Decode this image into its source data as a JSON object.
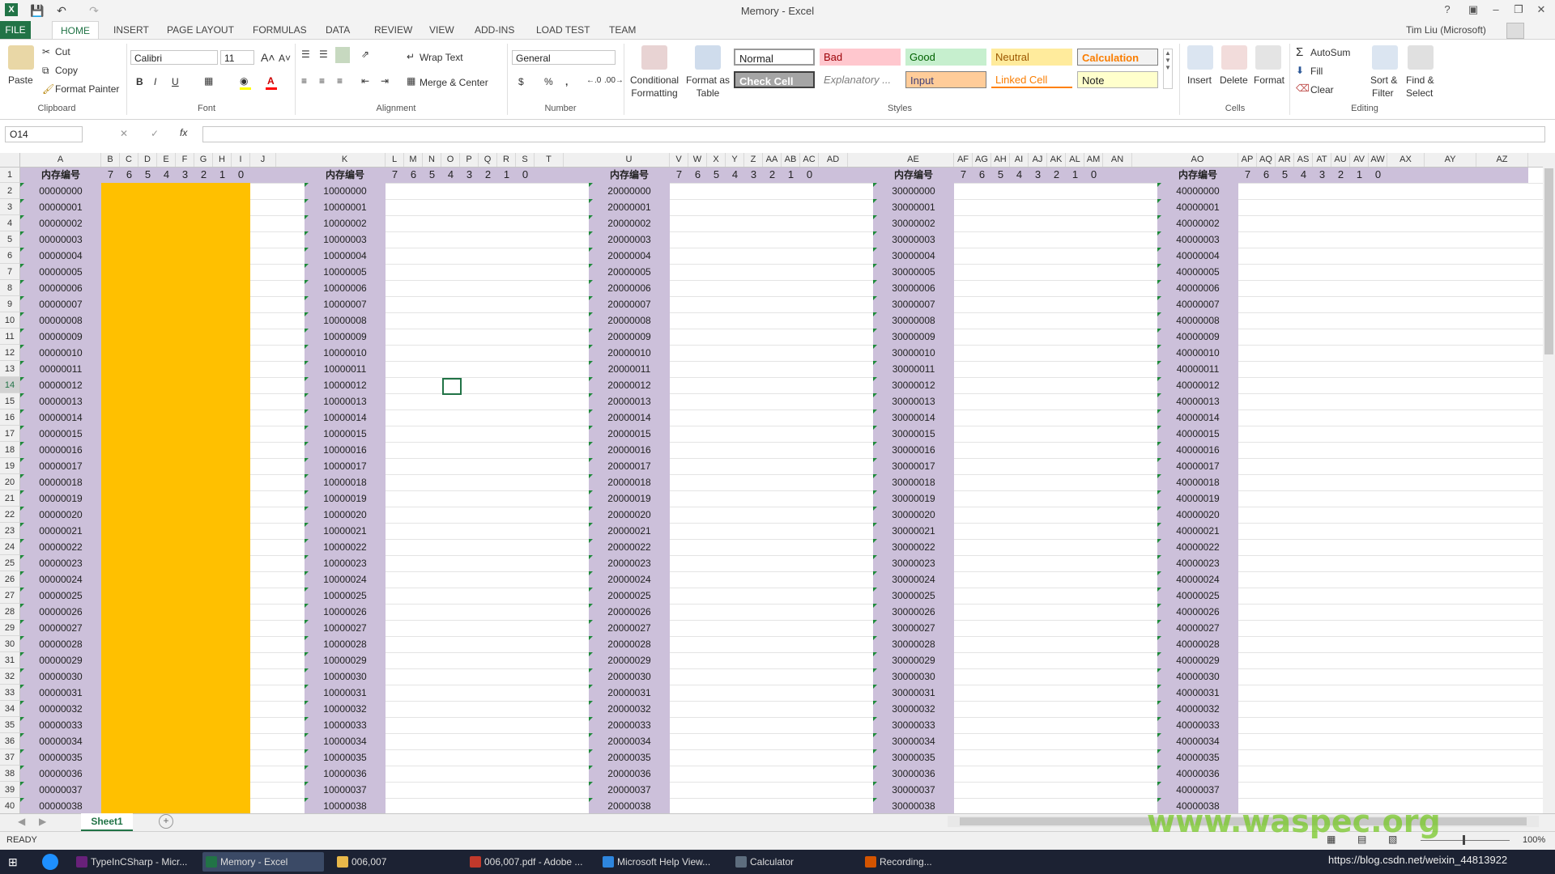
{
  "window": {
    "title": "Memory - Excel",
    "user": "Tim Liu (Microsoft)"
  },
  "tabs": [
    "FILE",
    "HOME",
    "INSERT",
    "PAGE LAYOUT",
    "FORMULAS",
    "DATA",
    "REVIEW",
    "VIEW",
    "ADD-INS",
    "LOAD TEST",
    "TEAM"
  ],
  "clipboard": {
    "paste": "Paste",
    "cut": "Cut",
    "copy": "Copy",
    "format_painter": "Format Painter",
    "label": "Clipboard"
  },
  "font": {
    "name": "Calibri",
    "size": "11",
    "bold": "B",
    "italic": "I",
    "underline": "U",
    "label": "Font"
  },
  "alignment": {
    "wrap_text": "Wrap Text",
    "merge_center": "Merge & Center",
    "label": "Alignment"
  },
  "number": {
    "format": "General",
    "currency": "$",
    "percent": "%",
    "comma": ",",
    "label": "Number"
  },
  "styles_cmds": {
    "conditional": "Conditional",
    "formatting": "Formatting",
    "format_as": "Format as",
    "table": "Table",
    "label": "Styles"
  },
  "styles": {
    "normal": "Normal",
    "bad": "Bad",
    "good": "Good",
    "neutral": "Neutral",
    "calculation": "Calculation",
    "check_cell": "Check Cell",
    "explanatory": "Explanatory ...",
    "input": "Input",
    "linked_cell": "Linked Cell",
    "note": "Note"
  },
  "cells_cmds": {
    "insert": "Insert",
    "delete": "Delete",
    "format": "Format",
    "label": "Cells"
  },
  "editing": {
    "autosum": "AutoSum",
    "fill": "Fill",
    "clear": "Clear",
    "sort": "Sort &",
    "filter": "Filter",
    "find": "Find &",
    "select": "Select",
    "label": "Editing"
  },
  "formula_bar": {
    "name_box": "O14",
    "cancel": "✕",
    "enter": "✓",
    "fx": "fx",
    "value": ""
  },
  "columns": {
    "headers_a": [
      "A",
      "B",
      "C",
      "D",
      "E",
      "F",
      "G",
      "H",
      "I",
      "J"
    ],
    "headers_b": [
      "K",
      "L",
      "M",
      "N",
      "O",
      "P",
      "Q",
      "R",
      "S",
      "T"
    ],
    "headers_c": [
      "U",
      "V",
      "W",
      "X",
      "Y",
      "Z",
      "AA",
      "AB",
      "AC",
      "AD"
    ],
    "headers_d": [
      "AE",
      "AF",
      "AG",
      "AH",
      "AI",
      "AJ",
      "AK",
      "AL",
      "AM",
      "AN"
    ],
    "headers_e": [
      "AO",
      "AP",
      "AQ",
      "AR",
      "AS",
      "AT",
      "AU",
      "AV",
      "AW",
      "AX",
      "AY",
      "AZ"
    ]
  },
  "header_row": {
    "label": "内存编号",
    "bits": [
      "7",
      "6",
      "5",
      "4",
      "3",
      "2",
      "1",
      "0"
    ]
  },
  "row_numbers": [
    "1",
    "2",
    "3",
    "4",
    "5",
    "6",
    "7",
    "8",
    "9",
    "10",
    "11",
    "12",
    "13",
    "14",
    "15",
    "16",
    "17",
    "18",
    "19",
    "20",
    "21",
    "22",
    "23",
    "24",
    "25",
    "26",
    "27",
    "28",
    "29",
    "30",
    "31",
    "32",
    "33",
    "34",
    "35",
    "36",
    "37",
    "38",
    "39",
    "40"
  ],
  "blocks": [
    {
      "addresses": [
        "00000000",
        "00000001",
        "00000002",
        "00000003",
        "00000004",
        "00000005",
        "00000006",
        "00000007",
        "00000008",
        "00000009",
        "00000010",
        "00000011",
        "00000012",
        "00000013",
        "00000014",
        "00000015",
        "00000016",
        "00000017",
        "00000018",
        "00000019",
        "00000020",
        "00000021",
        "00000022",
        "00000023",
        "00000024",
        "00000025",
        "00000026",
        "00000027",
        "00000028",
        "00000029",
        "00000030",
        "00000031",
        "00000032",
        "00000033",
        "00000034",
        "00000035",
        "00000036",
        "00000037",
        "00000038"
      ]
    },
    {
      "addresses": [
        "10000000",
        "10000001",
        "10000002",
        "10000003",
        "10000004",
        "10000005",
        "10000006",
        "10000007",
        "10000008",
        "10000009",
        "10000010",
        "10000011",
        "10000012",
        "10000013",
        "10000014",
        "10000015",
        "10000016",
        "10000017",
        "10000018",
        "10000019",
        "10000020",
        "10000021",
        "10000022",
        "10000023",
        "10000024",
        "10000025",
        "10000026",
        "10000027",
        "10000028",
        "10000029",
        "10000030",
        "10000031",
        "10000032",
        "10000033",
        "10000034",
        "10000035",
        "10000036",
        "10000037",
        "10000038"
      ]
    },
    {
      "addresses": [
        "20000000",
        "20000001",
        "20000002",
        "20000003",
        "20000004",
        "20000005",
        "20000006",
        "20000007",
        "20000008",
        "20000009",
        "20000010",
        "20000011",
        "20000012",
        "20000013",
        "20000014",
        "20000015",
        "20000016",
        "20000017",
        "20000018",
        "20000019",
        "20000020",
        "20000021",
        "20000022",
        "20000023",
        "20000024",
        "20000025",
        "20000026",
        "20000027",
        "20000028",
        "20000029",
        "20000030",
        "20000031",
        "20000032",
        "20000033",
        "20000034",
        "20000035",
        "20000036",
        "20000037",
        "20000038"
      ]
    },
    {
      "addresses": [
        "30000000",
        "30000001",
        "30000002",
        "30000003",
        "30000004",
        "30000005",
        "30000006",
        "30000007",
        "30000008",
        "30000009",
        "30000010",
        "30000011",
        "30000012",
        "30000013",
        "30000014",
        "30000015",
        "30000016",
        "30000017",
        "30000018",
        "30000019",
        "30000020",
        "30000021",
        "30000022",
        "30000023",
        "30000024",
        "30000025",
        "30000026",
        "30000027",
        "30000028",
        "30000029",
        "30000030",
        "30000031",
        "30000032",
        "30000033",
        "30000034",
        "30000035",
        "30000036",
        "30000037",
        "30000038"
      ]
    },
    {
      "addresses": [
        "40000000",
        "40000001",
        "40000002",
        "40000003",
        "40000004",
        "40000005",
        "40000006",
        "40000007",
        "40000008",
        "40000009",
        "40000010",
        "40000011",
        "40000012",
        "40000013",
        "40000014",
        "40000015",
        "40000016",
        "40000017",
        "40000018",
        "40000019",
        "40000020",
        "40000021",
        "40000022",
        "40000023",
        "40000024",
        "40000025",
        "40000026",
        "40000027",
        "40000028",
        "40000029",
        "40000030",
        "40000031",
        "40000032",
        "40000033",
        "40000034",
        "40000035",
        "40000036",
        "40000037",
        "40000038"
      ]
    }
  ],
  "sheet": {
    "tab": "Sheet1",
    "add": "+"
  },
  "status": {
    "ready": "READY",
    "zoom": "100%"
  },
  "taskbar": [
    "TypeInCSharp - Micr...",
    "Memory - Excel",
    "006,007",
    "006,007.pdf - Adobe ...",
    "Microsoft Help View...",
    "Calculator",
    "Recording..."
  ],
  "watermark": "www.waspec.org",
  "url_overlay": "https://blog.csdn.net/weixin_44813922",
  "colors": {
    "purple": "#ccc0da",
    "orange": "#ffc000",
    "excel_green": "#217346"
  }
}
